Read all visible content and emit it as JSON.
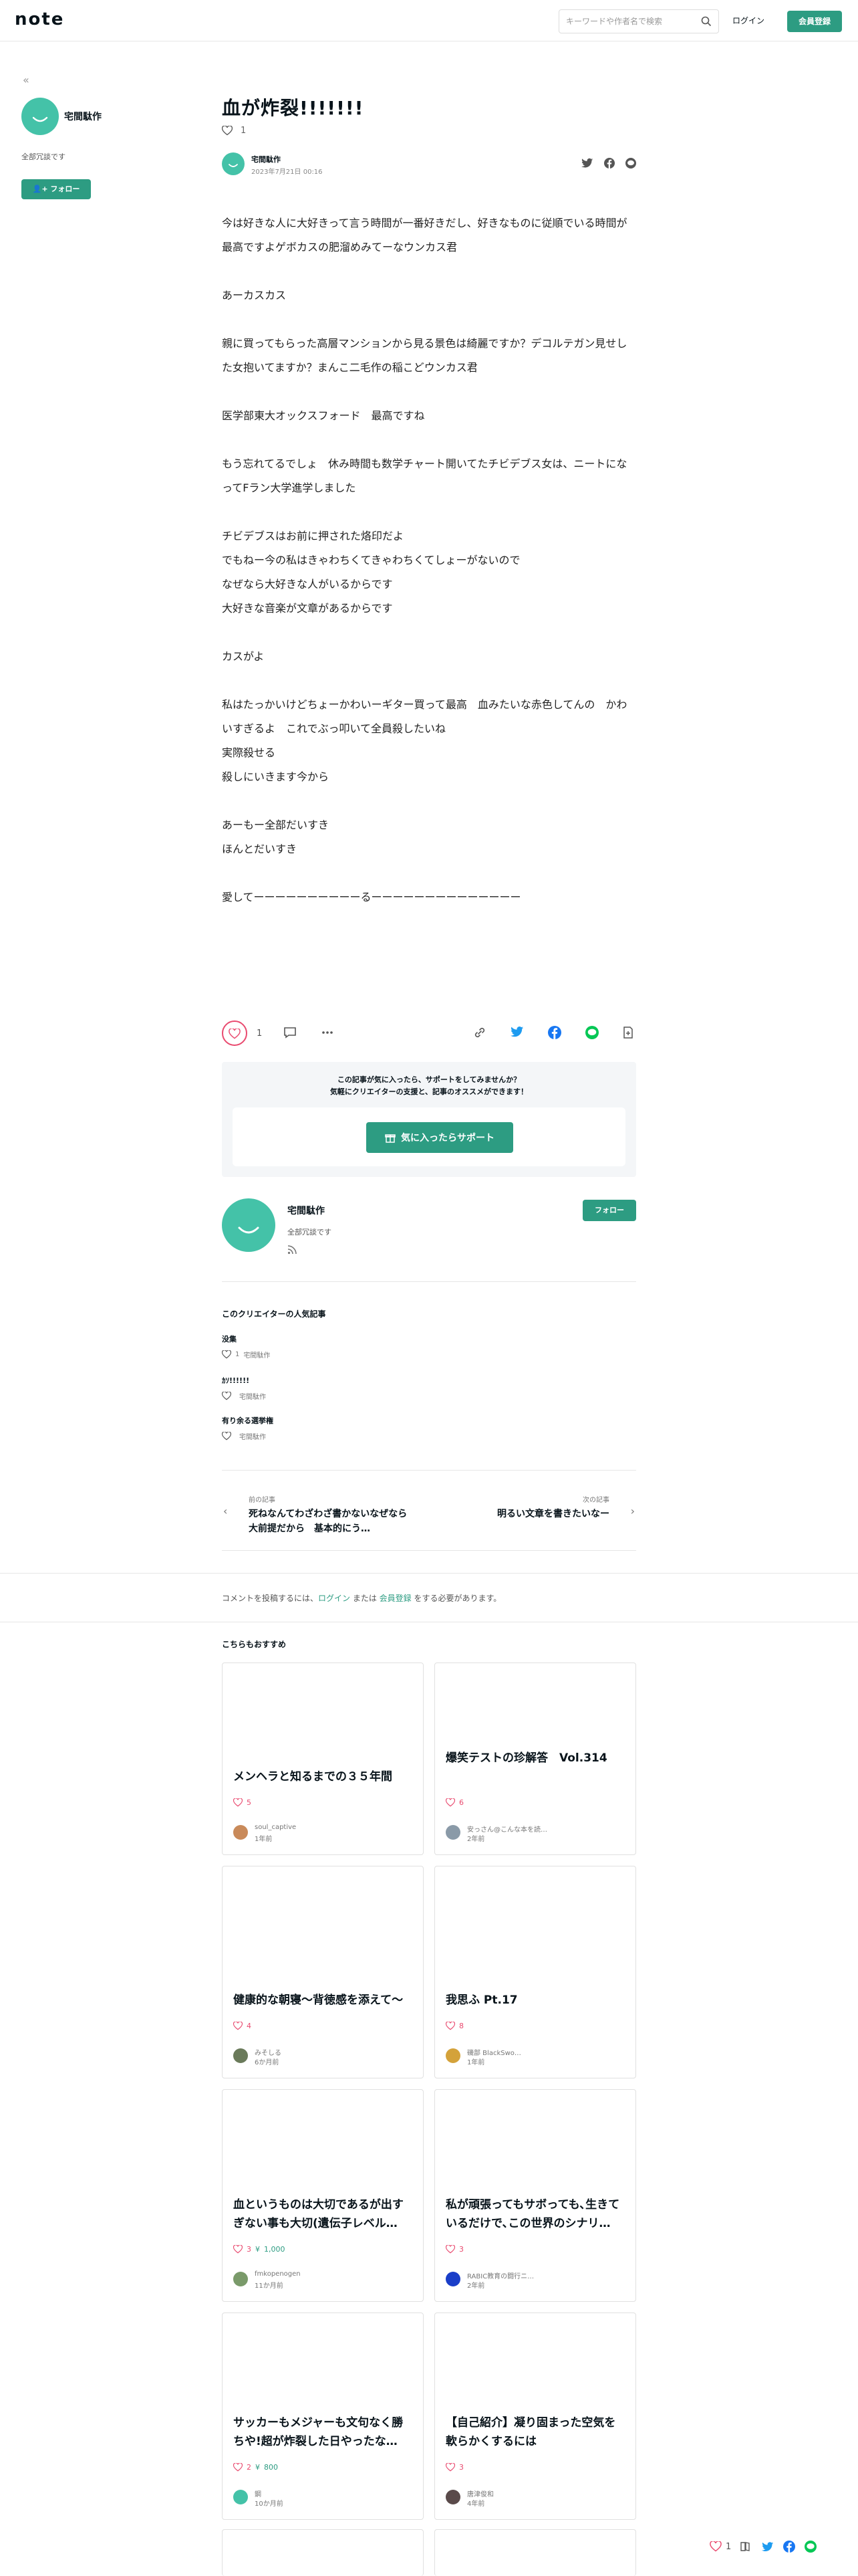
{
  "header": {
    "logo": "note",
    "search_placeholder": "キーワードや作者名で検索",
    "login": "ログイン",
    "signup": "会員登録"
  },
  "sidebar": {
    "name": "宅間駄作",
    "bio": "全部冗談です",
    "follow": "フォロー"
  },
  "article": {
    "title": "血が炸裂!!!!!!!",
    "like_count": "1",
    "author": "宅間駄作",
    "date": "2023年7月21日 00:16",
    "paragraphs": [
      "今は好きな人に大好きって言う時間が一番好きだし、好きなものに従順でいる時間が最高ですよゲボカスの肥溜めみてーなウンカス君",
      "",
      "あーカスカス",
      "",
      "親に買ってもらった高層マンションから見る景色は綺麗ですか？デコルテガン見せした女抱いてますか？まんこ二毛作の稲こどウンカス君",
      "",
      "医学部東大オックスフォード　最高ですね",
      "",
      "もう忘れてるでしょ　休み時間も数学チャート開いてたチビデブス女は、ニートになってFラン大学進学しました",
      "",
      "チビデブスはお前に押された烙印だよ",
      "でもねー今の私はきゃわちくてきゃわちくてしょーがないので",
      "なぜなら大好きな人がいるからです",
      "大好きな音楽が文章があるからです",
      "",
      "カスがよ",
      "",
      "私はたっかいけどちょーかわいーギター買って最高　血みたいな赤色してんの　かわいすぎるよ　これでぶっ叩いて全員殺したいね",
      "実際殺せる",
      "殺しにいきます今から",
      "",
      "あーもー全部だいすき",
      "ほんとだいすき",
      "",
      "愛してーーーーーーーーーーるーーーーーーーーーーーーーー"
    ]
  },
  "actions": {
    "like_count": "1"
  },
  "support": {
    "line1": "この記事が気に入ったら、サポートをしてみませんか？",
    "line2": "気軽にクリエイターの支援と、記事のオススメができます！",
    "button": "気に入ったらサポート"
  },
  "creator": {
    "name": "宅間駄作",
    "bio": "全部冗談です",
    "follow": "フォロー"
  },
  "popular": {
    "title": "このクリエイターの人気記事",
    "items": [
      {
        "title": "没集",
        "likes": "1",
        "author": "宅間駄作"
      },
      {
        "title": "ｶｿ!!!!!!",
        "likes": "",
        "author": "宅間駄作"
      },
      {
        "title": "有り余る選挙権",
        "likes": "",
        "author": "宅間駄作"
      }
    ]
  },
  "nav": {
    "prev_label": "前の記事",
    "prev_title": "死ねなんてわざわざ書かないなぜなら大前提だから　基本的にう…",
    "next_label": "次の記事",
    "next_title": "明るい文章を書きたいなー"
  },
  "comment": {
    "prefix": "コメントを投稿するには、",
    "login": "ログイン",
    "middle": " または ",
    "signup": "会員登録",
    "suffix": " をする必要があります。"
  },
  "recommend": {
    "title": "こちらもおすすめ",
    "cards": [
      {
        "title": "メンヘラと知るまでの３５年間",
        "likes": "5",
        "price": "",
        "author": "soul_captive",
        "time": "1年前",
        "avatar_color": "#c98a5a"
      },
      {
        "title": "爆笑テストの珍解答　Vol.314",
        "likes": "6",
        "price": "",
        "author": "安っさん@こんな本を読…",
        "time": "2年前",
        "avatar_color": "#8a9aa8"
      },
      {
        "title": "健康的な朝寝〜背徳感を添えて〜",
        "likes": "4",
        "price": "",
        "author": "みそしる",
        "time": "6か月前",
        "avatar_color": "#6a7a5a"
      },
      {
        "title": "我思ふ Pt.17",
        "likes": "8",
        "price": "",
        "author": "磯部 BlackSwo…",
        "time": "1年前",
        "avatar_color": "#d4a23a"
      },
      {
        "title": "血というものは大切であるが出すぎない事も大切(遺伝子レベル…",
        "likes": "3",
        "price": "1,000",
        "author": "fmkopenogen",
        "time": "11か月前",
        "avatar_color": "#7a9a6a"
      },
      {
        "title": "私が頑張ってもサボっても､生きているだけで､この世界のシナリ…",
        "likes": "3",
        "price": "",
        "author": "RABIC教育の闘行ニ…",
        "time": "2年前",
        "avatar_color": "#1a3ec8"
      },
      {
        "title": "サッカーもメジャーも文句なく勝ちや!超が炸裂した日やったな…",
        "likes": "2",
        "price": "800",
        "author": "鋼",
        "time": "10か月前",
        "avatar_color": "#44c2a8"
      },
      {
        "title": "【自己紹介】凝り固まった空気を軟らかくするには",
        "likes": "3",
        "price": "",
        "author": "唐津俊和",
        "time": "4年前",
        "avatar_color": "#5a4a4a"
      }
    ]
  },
  "floating": {
    "like_count": "1"
  },
  "colors": {
    "accent": "#2d9c82",
    "avatar": "#44c2a8",
    "like": "#e94a6f",
    "twitter": "#1d9bf0",
    "facebook": "#1877f2",
    "line": "#06c755"
  }
}
